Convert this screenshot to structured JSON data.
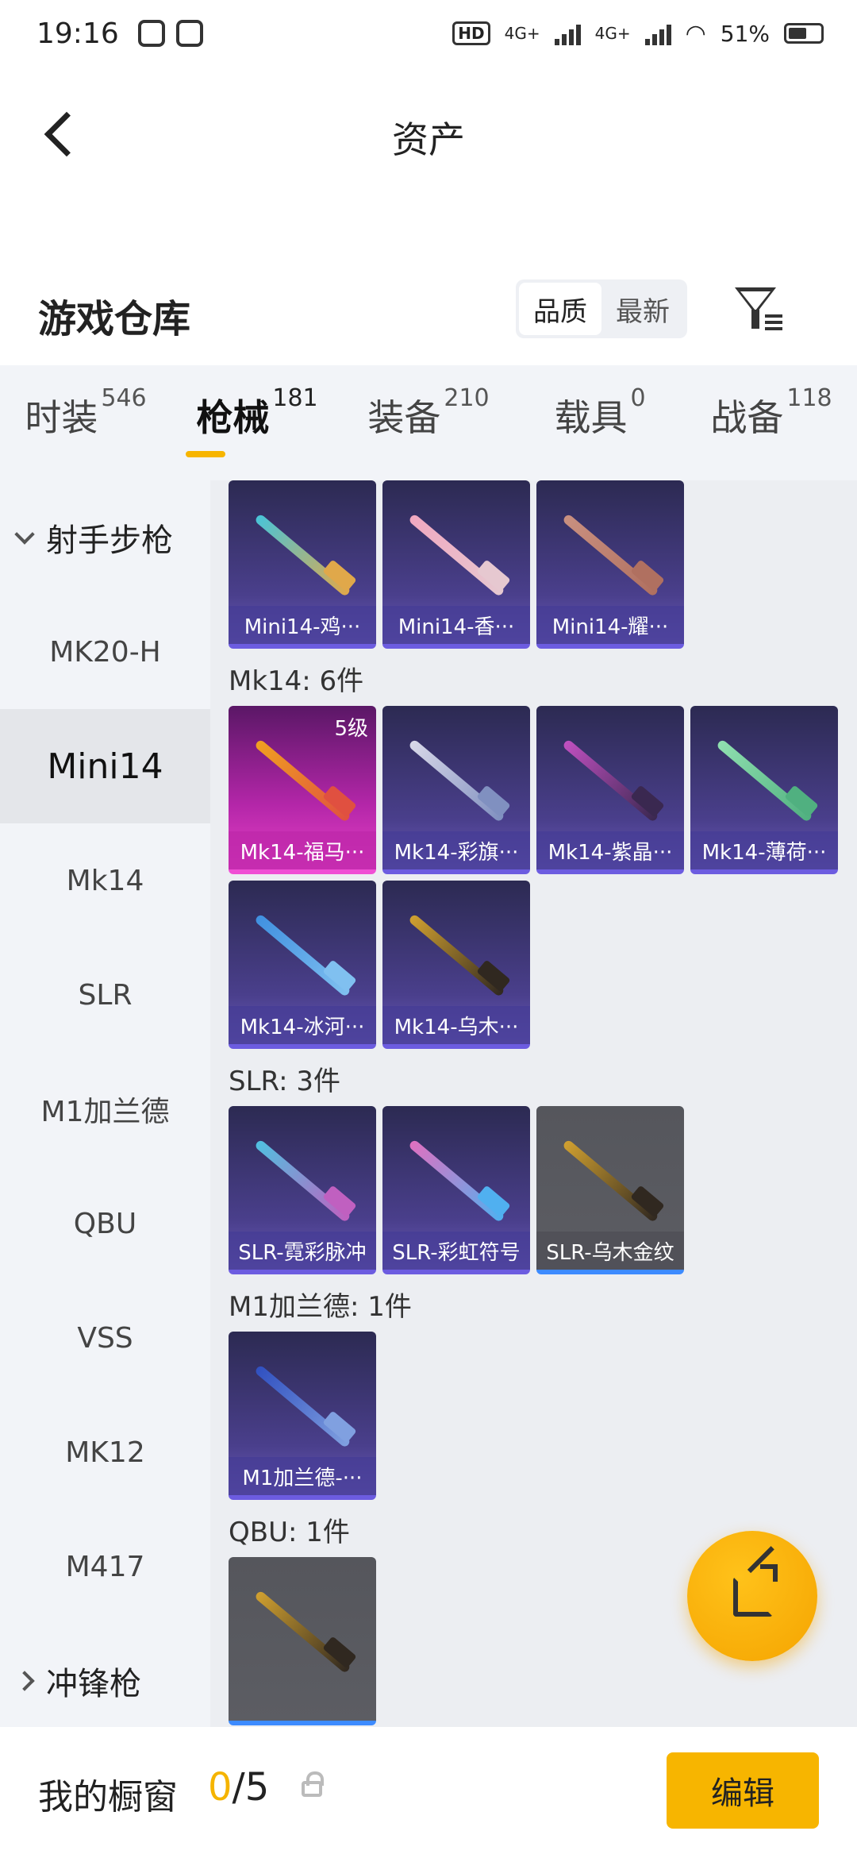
{
  "status_bar": {
    "time": "19:16",
    "network_1": "4G+",
    "network_2": "4G+",
    "battery": "51%"
  },
  "header": {
    "title": "资产"
  },
  "warehouse": {
    "title": "游戏仓库",
    "sort_options": [
      "品质",
      "最新"
    ],
    "active_sort": "品质"
  },
  "tabs": [
    {
      "label": "时装",
      "count": "546"
    },
    {
      "label": "枪械",
      "count": "181",
      "active": true
    },
    {
      "label": "装备",
      "count": "210"
    },
    {
      "label": "载具",
      "count": "0"
    },
    {
      "label": "战备",
      "count": "118"
    }
  ],
  "sidebar": {
    "items": [
      {
        "label": "射手步枪",
        "type": "group-expanded"
      },
      {
        "label": "MK20-H"
      },
      {
        "label": "Mini14",
        "active": true
      },
      {
        "label": "Mk14"
      },
      {
        "label": "SLR"
      },
      {
        "label": "M1加兰德"
      },
      {
        "label": "QBU"
      },
      {
        "label": "VSS"
      },
      {
        "label": "MK12"
      },
      {
        "label": "M417"
      },
      {
        "label": "冲锋枪",
        "type": "group-collapsed"
      }
    ]
  },
  "sections": [
    {
      "label": "",
      "items": [
        {
          "name": "Mini14-鸡···",
          "colors": [
            "#49c4d8",
            "#e0a84a"
          ],
          "rarity": "purple"
        },
        {
          "name": "Mini14-香···",
          "colors": [
            "#f0a8c0",
            "#e6c8d0"
          ],
          "rarity": "purple"
        },
        {
          "name": "Mini14-耀···",
          "colors": [
            "#c99080",
            "#b07060"
          ],
          "rarity": "purple"
        }
      ]
    },
    {
      "label": "Mk14: 6件",
      "items": [
        {
          "name": "Mk14-福马···",
          "colors": [
            "#f0a020",
            "#e05040"
          ],
          "rarity": "pink",
          "level": "5级"
        },
        {
          "name": "Mk14-彩旗···",
          "colors": [
            "#d8d8e8",
            "#8090c0"
          ],
          "rarity": "purple"
        },
        {
          "name": "Mk14-紫晶···",
          "colors": [
            "#c050c0",
            "#3a2850"
          ],
          "rarity": "purple"
        },
        {
          "name": "Mk14-薄荷···",
          "colors": [
            "#90e0b0",
            "#50b080"
          ],
          "rarity": "purple"
        },
        {
          "name": "Mk14-冰河···",
          "colors": [
            "#4090e0",
            "#80c0f0"
          ],
          "rarity": "purple"
        },
        {
          "name": "Mk14-乌木···",
          "colors": [
            "#d0a030",
            "#302820"
          ],
          "rarity": "purple"
        }
      ]
    },
    {
      "label": "SLR: 3件",
      "items": [
        {
          "name": "SLR-霓彩脉冲",
          "colors": [
            "#50c0e0",
            "#c060c0"
          ],
          "rarity": "purple"
        },
        {
          "name": "SLR-彩虹符号",
          "colors": [
            "#e070c0",
            "#50b0f0"
          ],
          "rarity": "purple"
        },
        {
          "name": "SLR-乌木金纹",
          "colors": [
            "#d0a030",
            "#302820"
          ],
          "rarity": "gray"
        }
      ]
    },
    {
      "label": "M1加兰德: 1件",
      "items": [
        {
          "name": "M1加兰德-···",
          "colors": [
            "#3050c0",
            "#80a0e0"
          ],
          "rarity": "purple"
        }
      ]
    },
    {
      "label": "QBU: 1件",
      "items": [
        {
          "name": "",
          "colors": [
            "#d0a030",
            "#302820"
          ],
          "rarity": "gray"
        }
      ]
    }
  ],
  "bottom_bar": {
    "label": "我的橱窗",
    "current": "0",
    "total": "/5",
    "edit_label": "编辑"
  }
}
